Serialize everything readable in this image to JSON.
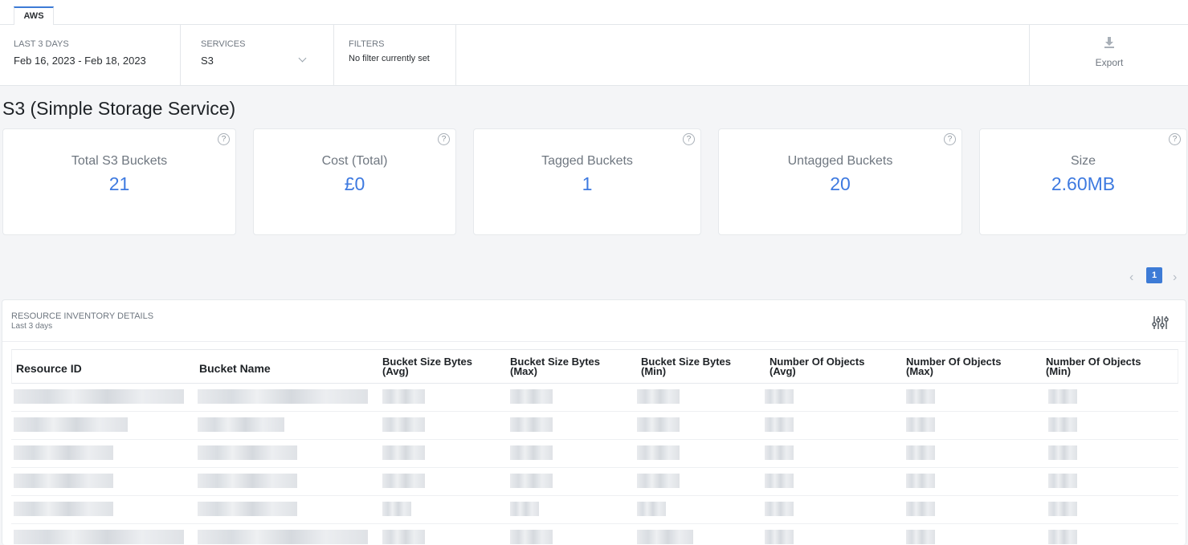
{
  "tabs": [
    {
      "label": "AWS",
      "active": true
    }
  ],
  "filters": {
    "date": {
      "label": "LAST 3 DAYS",
      "value": "Feb 16, 2023 - Feb 18, 2023"
    },
    "services": {
      "label": "SERVICES",
      "value": "S3"
    },
    "filters": {
      "label": "FILTERS",
      "value": "No filter currently set"
    },
    "export_label": "Export"
  },
  "page_title": "S3 (Simple Storage Service)",
  "kpis": [
    {
      "label": "Total S3 Buckets",
      "value": "21"
    },
    {
      "label": "Cost (Total)",
      "value": "£0"
    },
    {
      "label": "Tagged Buckets",
      "value": "1"
    },
    {
      "label": "Untagged Buckets",
      "value": "20"
    },
    {
      "label": "Size",
      "value": "2.60MB"
    }
  ],
  "help_glyph": "?",
  "pagination": {
    "prev": "‹",
    "current": "1",
    "next": "›"
  },
  "panel": {
    "title": "RESOURCE INVENTORY DETAILS",
    "subtitle": "Last 3 days"
  },
  "table": {
    "columns": [
      {
        "line1": "Resource ID",
        "line2": ""
      },
      {
        "line1": "Bucket Name",
        "line2": ""
      },
      {
        "line1": "Bucket Size Bytes",
        "line2": "(Avg)"
      },
      {
        "line1": "Bucket Size Bytes",
        "line2": "(Max)"
      },
      {
        "line1": "Bucket Size Bytes",
        "line2": "(Min)"
      },
      {
        "line1": "Number Of Objects",
        "line2": "(Avg)"
      },
      {
        "line1": "Number Of Objects",
        "line2": "(Max)"
      },
      {
        "line1": "Number Of Objects",
        "line2": "(Min)"
      }
    ],
    "rows_note_redacted": true
  },
  "colors": {
    "accent": "#3d7bd6",
    "kpi_value": "#3e7ae0"
  },
  "icons": [
    "download-icon",
    "chevron-down-icon",
    "help-circle-icon",
    "column-settings-icon",
    "chevron-left-icon",
    "chevron-right-icon"
  ]
}
